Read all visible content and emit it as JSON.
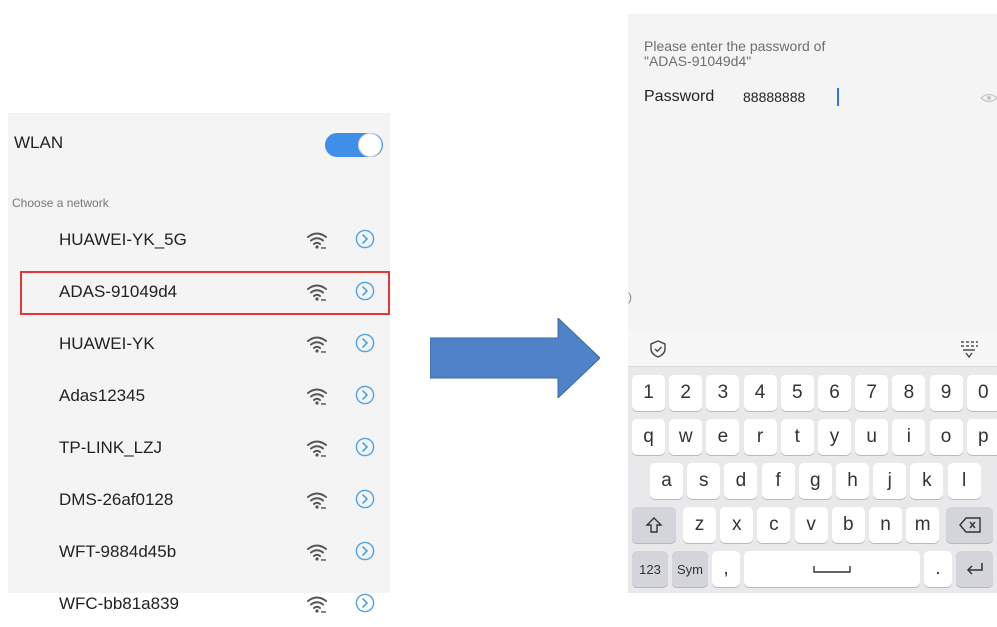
{
  "wlan": {
    "title": "WLAN",
    "toggle_on": true,
    "accent_color": "#3f8ee8",
    "section_title": "Choose a network",
    "networks": [
      {
        "name": "HUAWEI-YK_5G",
        "highlighted": false
      },
      {
        "name": "ADAS-91049d4",
        "highlighted": true
      },
      {
        "name": "HUAWEI-YK",
        "highlighted": false
      },
      {
        "name": "Adas12345",
        "highlighted": false
      },
      {
        "name": "TP-LINK_LZJ",
        "highlighted": false
      },
      {
        "name": "DMS-26af0128",
        "highlighted": false
      },
      {
        "name": "WFT-9884d45b",
        "highlighted": false
      },
      {
        "name": "WFC-bb81a839",
        "highlighted": false
      }
    ],
    "highlight_color": "#e23838"
  },
  "arrow": {
    "color": "#4f82c6",
    "direction": "right"
  },
  "password_screen": {
    "prompt_line1": "Please enter the password of",
    "prompt_line2": "\"ADAS-91049d4\"",
    "password_label": "Password",
    "password_value": "88888888",
    "left_mark": ")"
  },
  "keyboard": {
    "row_numbers": [
      "1",
      "2",
      "3",
      "4",
      "5",
      "6",
      "7",
      "8",
      "9",
      "0"
    ],
    "row_q": [
      "q",
      "w",
      "e",
      "r",
      "t",
      "y",
      "u",
      "i",
      "o",
      "p"
    ],
    "row_a": [
      "a",
      "s",
      "d",
      "f",
      "g",
      "h",
      "j",
      "k",
      "l"
    ],
    "row_z": [
      "z",
      "x",
      "c",
      "v",
      "b",
      "n",
      "m"
    ],
    "key_123": "123",
    "key_sym": "Sym",
    "key_comma": ",",
    "key_period": "."
  }
}
